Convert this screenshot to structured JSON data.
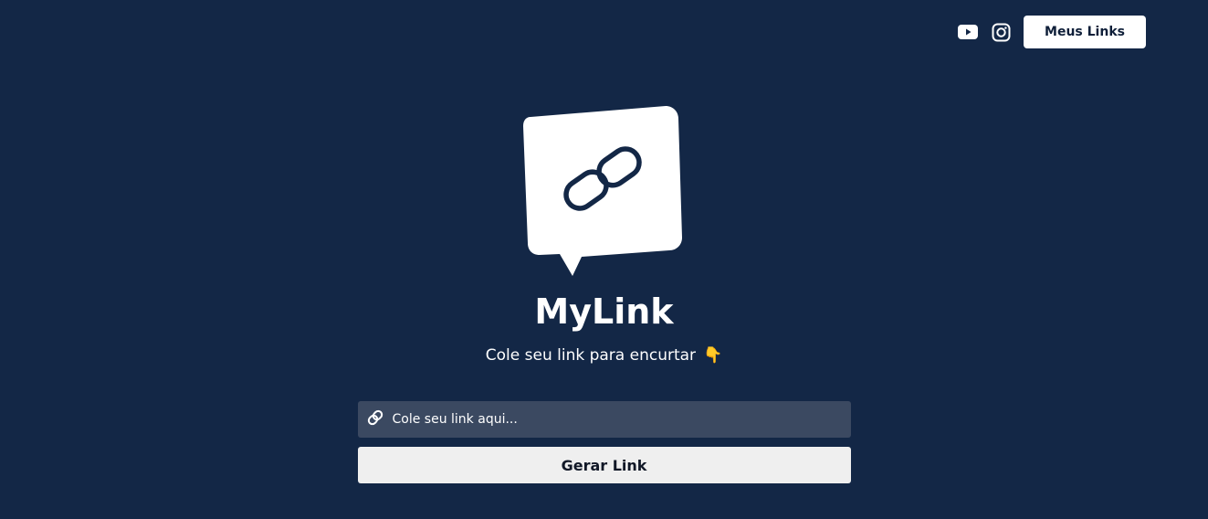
{
  "header": {
    "youtube_icon": "youtube-icon",
    "instagram_icon": "instagram-icon",
    "my_links_label": "Meus Links"
  },
  "hero": {
    "logo_icon": "chain-link-speech-bubble-icon",
    "title": "MyLink",
    "subtitle": "Cole seu link para encurtar",
    "subtitle_emoji": "👇"
  },
  "form": {
    "input_icon": "link-icon",
    "placeholder": "Cole seu link aqui...",
    "value": "",
    "submit_label": "Gerar Link"
  },
  "colors": {
    "background": "#132746",
    "input_background": "#3b4961",
    "button_background": "#efefef",
    "primary_text": "#ffffff"
  }
}
